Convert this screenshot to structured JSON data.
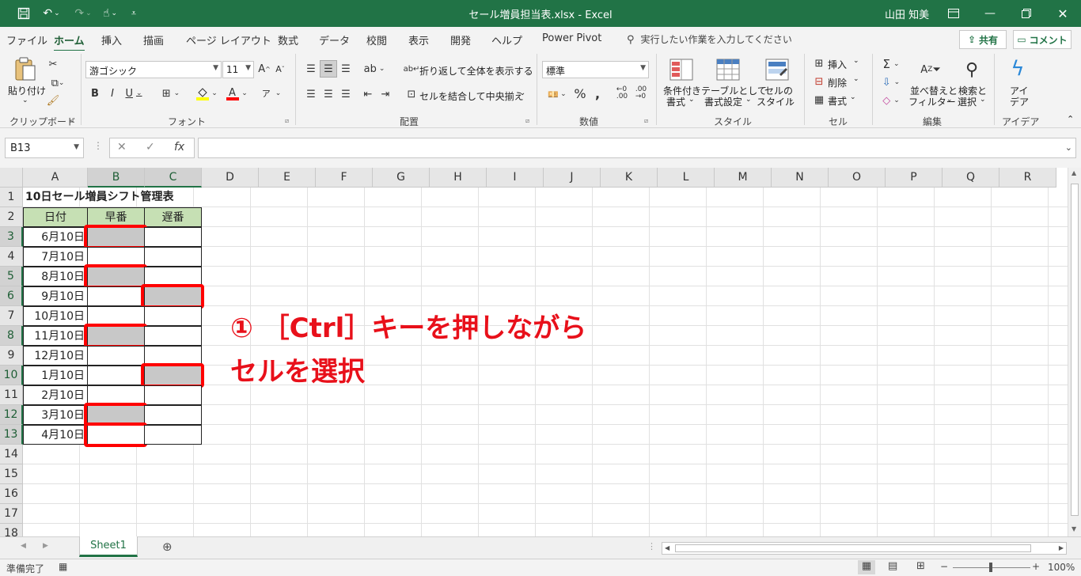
{
  "app": {
    "file_title": "セール増員担当表.xlsx  -  Excel",
    "user": "山田 知美"
  },
  "menu": {
    "tabs": [
      "ファイル",
      "ホーム",
      "挿入",
      "描画",
      "ページ レイアウト",
      "数式",
      "データ",
      "校閲",
      "表示",
      "開発",
      "ヘルプ",
      "Power Pivot"
    ],
    "active_tab": "ホーム",
    "tell_me": "実行したい作業を入力してください",
    "share": "共有",
    "comment": "コメント"
  },
  "ribbon": {
    "clipboard": {
      "label": "クリップボード",
      "paste": "貼り付け"
    },
    "font": {
      "label": "フォント",
      "name": "游ゴシック",
      "size": "11"
    },
    "alignment": {
      "label": "配置",
      "wrap": "折り返して全体を表示する",
      "merge": "セルを結合して中央揃え"
    },
    "number": {
      "label": "数値",
      "format": "標準"
    },
    "styles": {
      "label": "スタイル",
      "conditional_1": "条件付き",
      "conditional_2": "書式",
      "table_1": "テーブルとして",
      "table_2": "書式設定",
      "cell_style_1": "セルの",
      "cell_style_2": "スタイル"
    },
    "cells": {
      "label": "セル",
      "insert": "挿入",
      "delete": "削除",
      "format": "書式"
    },
    "editing": {
      "label": "編集",
      "sort_1": "並べ替えと",
      "sort_2": "フィルター",
      "find_1": "検索と",
      "find_2": "選択"
    },
    "ideas": {
      "label": "アイデア",
      "ideas_1": "アイ",
      "ideas_2": "デア"
    }
  },
  "formula_bar": {
    "name_box": "B13",
    "formula": ""
  },
  "sheet": {
    "columns": [
      "A",
      "B",
      "C",
      "D",
      "E",
      "F",
      "G",
      "H",
      "I",
      "J",
      "K",
      "L",
      "M",
      "N",
      "O",
      "P",
      "Q",
      "R"
    ],
    "rows": [
      "1",
      "2",
      "3",
      "4",
      "5",
      "6",
      "7",
      "8",
      "9",
      "10",
      "11",
      "12",
      "13",
      "14",
      "15",
      "16",
      "17",
      "18"
    ],
    "selected_columns": [
      "B",
      "C"
    ],
    "selected_rows": [
      "3",
      "5",
      "6",
      "8",
      "10",
      "12",
      "13"
    ],
    "title": "10日セール増員シフト管理表",
    "headers": [
      "日付",
      "早番",
      "遅番"
    ],
    "dates": [
      "6月10日",
      "7月10日",
      "8月10日",
      "9月10日",
      "10月10日",
      "11月10日",
      "12月10日",
      "1月10日",
      "2月10日",
      "3月10日",
      "4月10日"
    ],
    "selected_cells": [
      "B3",
      "B5",
      "C6",
      "B8",
      "C10",
      "B12",
      "B13"
    ]
  },
  "callout": {
    "line1": "① ［Ctrl］キーを押しながら",
    "line2": "セルを選択"
  },
  "sheet_tabs": {
    "active": "Sheet1"
  },
  "status": {
    "ready": "準備完了",
    "zoom": "100%"
  },
  "colors": {
    "excel_green": "#217346",
    "header_fill": "#c6e0b4",
    "selection_gray": "#c8c8c8",
    "callout_red": "#e8101a"
  }
}
